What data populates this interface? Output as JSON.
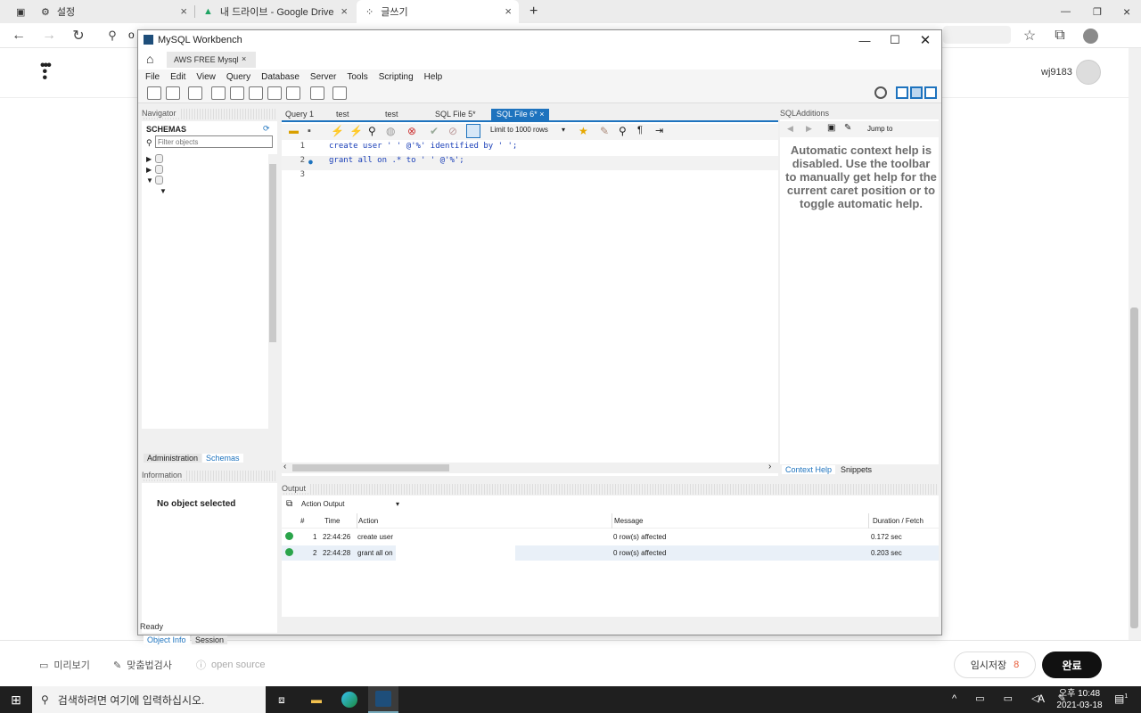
{
  "browser": {
    "tabs": [
      {
        "label": "설정"
      },
      {
        "label": "내 드라이브 - Google Drive"
      },
      {
        "label": "글쓰기"
      }
    ],
    "address_prefix": "o",
    "user": "wj9183"
  },
  "editor_bar": {
    "preview": "미리보기",
    "spellcheck": "맞춤법검사",
    "open_source": "open source",
    "temp_save": "임시저장",
    "temp_save_count": "8",
    "done": "완료"
  },
  "taskbar": {
    "search_placeholder": "검색하려면 여기에 입력하십시오.",
    "time": "오후 10:48",
    "date": "2021-03-18",
    "lang": "A",
    "notification_count": "1"
  },
  "workbench": {
    "title": "MySQL Workbench",
    "connection_tab": "AWS FREE Mysql",
    "menu": [
      "File",
      "Edit",
      "View",
      "Query",
      "Database",
      "Server",
      "Tools",
      "Scripting",
      "Help"
    ],
    "navigator": {
      "header": "Navigator",
      "schemas_label": "SCHEMAS",
      "filter_placeholder": "Filter objects",
      "tabs": [
        "Administration",
        "Schemas"
      ],
      "info_header": "Information",
      "no_object": "No object selected",
      "bottom_tabs": [
        "Object Info",
        "Session"
      ]
    },
    "query_tabs": [
      "Query 1",
      "test",
      "test",
      "SQL File 5*",
      "SQL File 6*"
    ],
    "limit_label": "Limit to 1000 rows",
    "code_lines": [
      {
        "n": "1",
        "text": "create user '        ' @'%' identified by '        ';"
      },
      {
        "n": "2",
        "text": "grant all on     .* to '      ' @'%';"
      },
      {
        "n": "3",
        "text": ""
      }
    ],
    "sql_additions": {
      "header": "SQLAdditions",
      "jump_to": "Jump to",
      "help_text": "Automatic context help is disabled. Use the toolbar to manually get help for the current caret position or to toggle automatic help.",
      "tabs": [
        "Context Help",
        "Snippets"
      ]
    },
    "output": {
      "header": "Output",
      "selector": "Action Output",
      "columns": [
        "#",
        "Time",
        "Action",
        "Message",
        "Duration / Fetch"
      ],
      "rows": [
        {
          "n": "1",
          "time": "22:44:26",
          "action": "create user",
          "message": "0 row(s) affected",
          "duration": "0.172 sec"
        },
        {
          "n": "2",
          "time": "22:44:28",
          "action": "grant all on",
          "message": "0 row(s) affected",
          "duration": "0.203 sec"
        }
      ]
    },
    "status": "Ready"
  }
}
